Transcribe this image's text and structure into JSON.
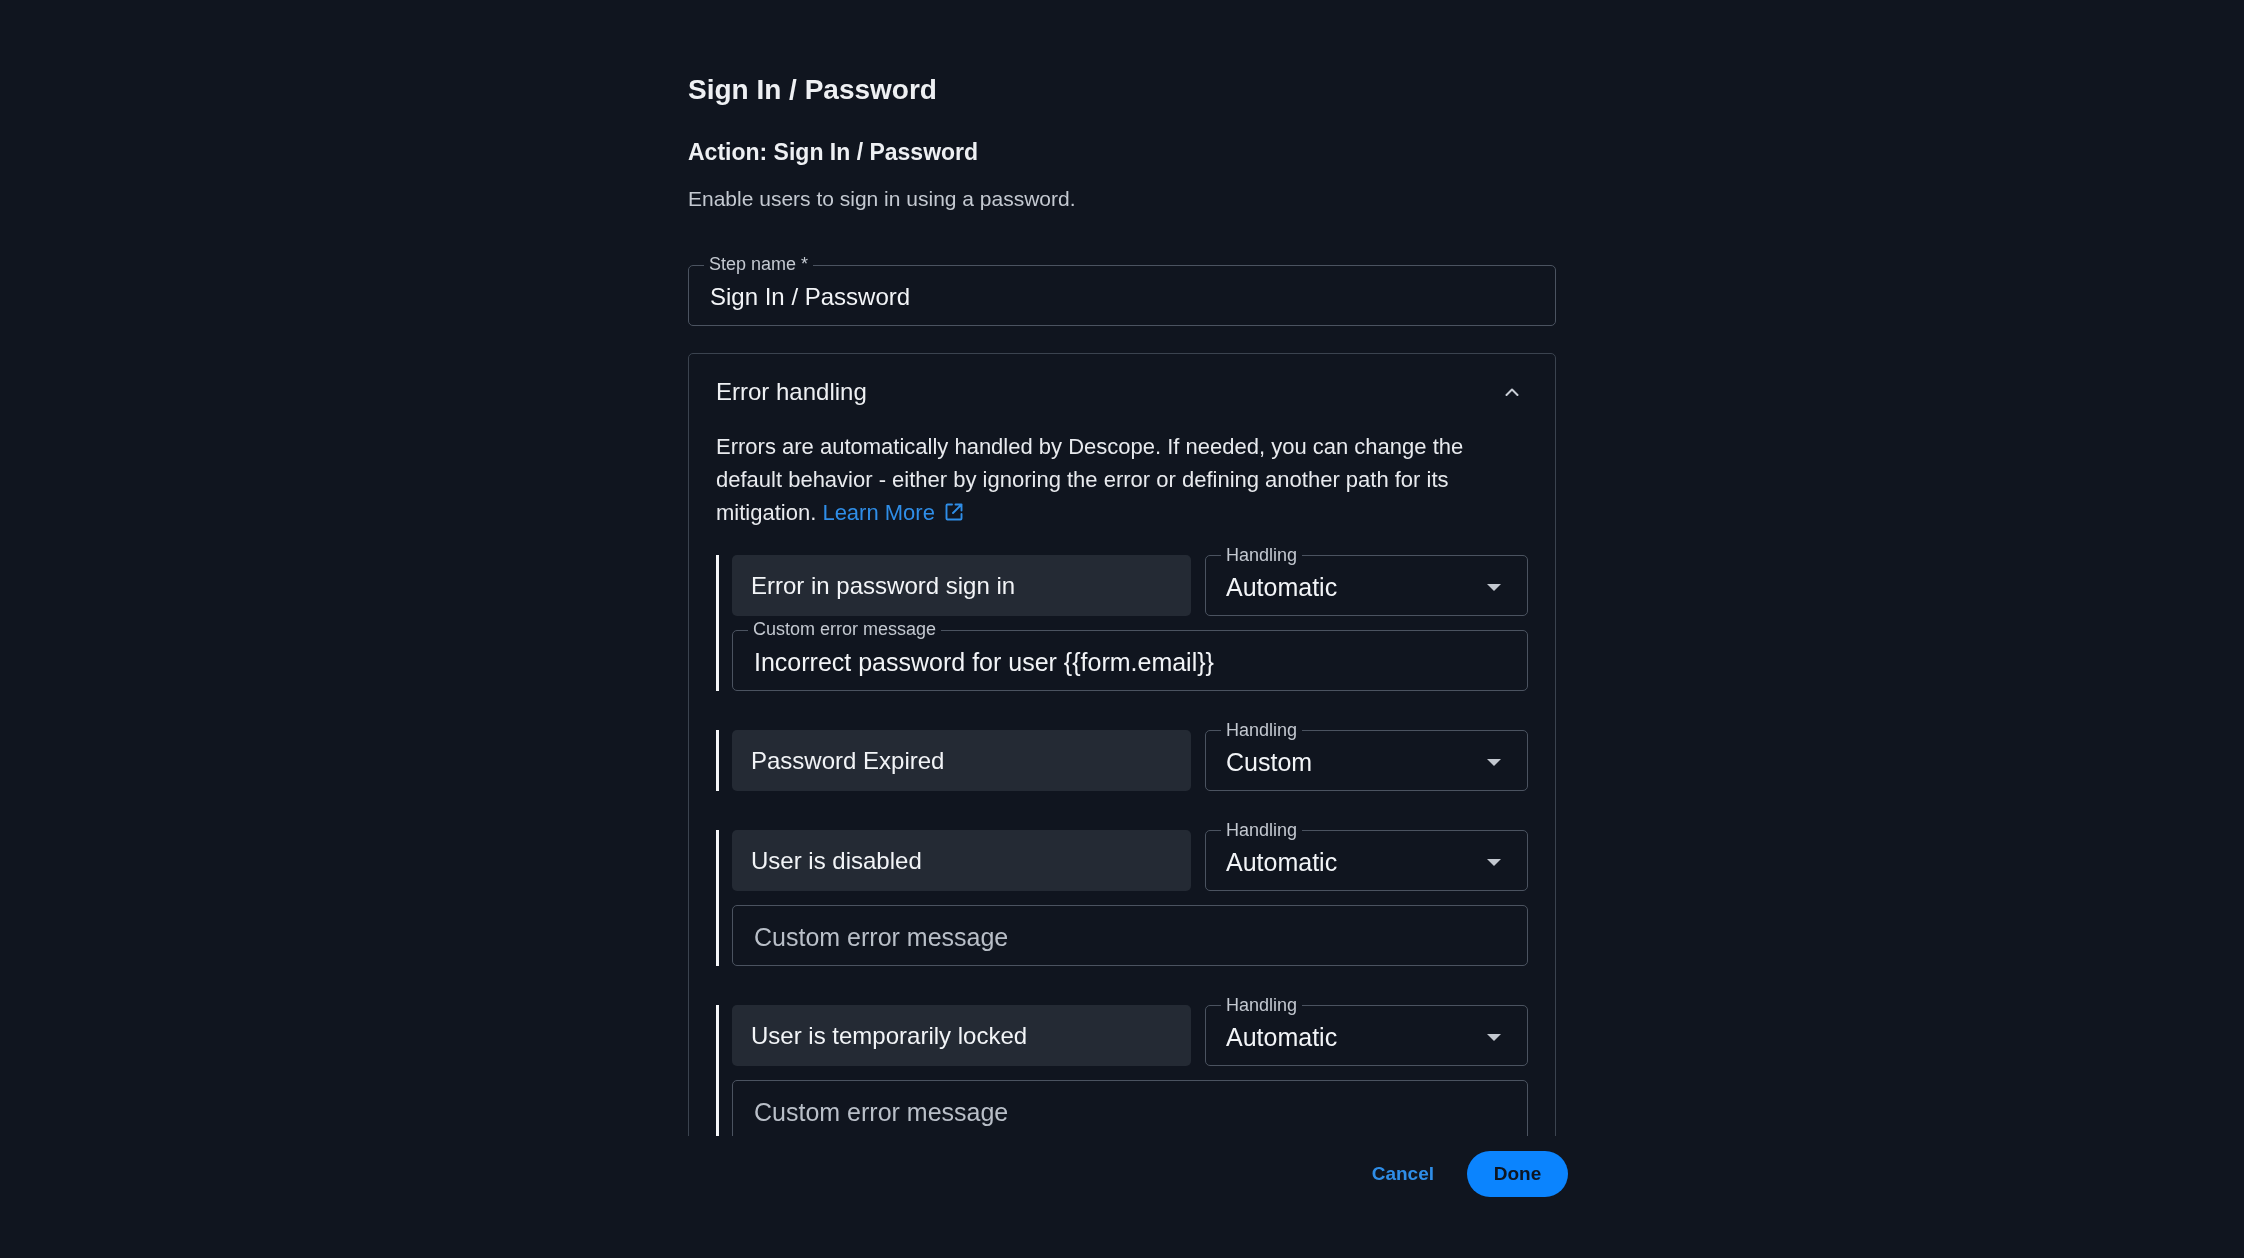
{
  "dialog": {
    "title": "Sign In / Password",
    "action_title": "Action: Sign In / Password",
    "description": "Enable users to sign in using a password."
  },
  "step_name": {
    "label": "Step name *",
    "value": "Sign In / Password"
  },
  "error_handling": {
    "title": "Error handling",
    "expanded": true,
    "description": "Errors are automatically handled by Descope. If needed, you can change the default behavior - either by ignoring the error or defining another path for its mitigation.",
    "link": "Learn More",
    "errors": [
      {
        "name": "Error in password sign in",
        "handling": {
          "label": "Handling",
          "value": "Automatic"
        },
        "message": {
          "label": "Custom error message",
          "value": "Incorrect password for user {{form.email}}"
        }
      },
      {
        "name": "Password Expired",
        "handling": {
          "label": "Handling",
          "value": "Custom"
        }
      },
      {
        "name": "User is disabled",
        "handling": {
          "label": "Handling",
          "value": "Automatic"
        },
        "message": {
          "placeholder": "Custom error message"
        }
      },
      {
        "name": "User is temporarily locked",
        "handling": {
          "label": "Handling",
          "value": "Automatic"
        },
        "message": {
          "placeholder": "Custom error message"
        }
      }
    ]
  },
  "buttons": [
    {
      "label": "Cancel",
      "kind": "text"
    },
    {
      "label": "Done",
      "kind": "primary"
    }
  ]
}
